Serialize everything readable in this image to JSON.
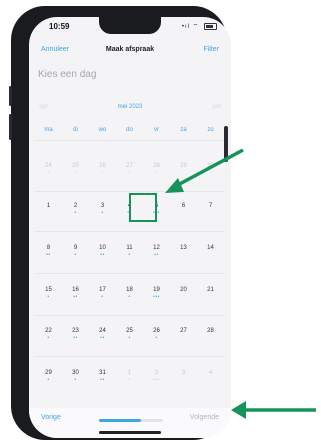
{
  "status_bar": {
    "time": "10:59",
    "signal_text": "•ıl ⌔"
  },
  "nav": {
    "left": "Annuleer",
    "title": "Maak afspraak",
    "right": "Filter"
  },
  "subtitle": "Kies een dag",
  "calendar": {
    "prev_month": "apr",
    "month": "mei 2023",
    "next_month": "jun",
    "weekdays": [
      "ma",
      "di",
      "wo",
      "do",
      "vr",
      "za",
      "zo"
    ],
    "weeks": [
      [
        {
          "d": "24",
          "dots": "•",
          "m": true
        },
        {
          "d": "25",
          "dots": "•",
          "m": true
        },
        {
          "d": "26",
          "dots": "•",
          "m": true
        },
        {
          "d": "27",
          "dots": "•",
          "m": true
        },
        {
          "d": "28",
          "dots": "•",
          "m": true
        },
        {
          "d": "29",
          "dots": "",
          "m": true
        },
        {
          "d": "30",
          "dots": "",
          "m": true
        }
      ],
      [
        {
          "d": "1",
          "dots": ""
        },
        {
          "d": "2",
          "dots": "•"
        },
        {
          "d": "3",
          "dots": "•"
        },
        {
          "d": "4",
          "dots": "••"
        },
        {
          "d": "5",
          "dots": "•••"
        },
        {
          "d": "6",
          "dots": ""
        },
        {
          "d": "7",
          "dots": ""
        }
      ],
      [
        {
          "d": "8",
          "dots": "••"
        },
        {
          "d": "9",
          "dots": "•"
        },
        {
          "d": "10",
          "dots": "••"
        },
        {
          "d": "11",
          "dots": "•"
        },
        {
          "d": "12",
          "dots": "••"
        },
        {
          "d": "13",
          "dots": ""
        },
        {
          "d": "14",
          "dots": ""
        }
      ],
      [
        {
          "d": "15",
          "dots": "•"
        },
        {
          "d": "16",
          "dots": "••"
        },
        {
          "d": "17",
          "dots": "•"
        },
        {
          "d": "18",
          "dots": "•"
        },
        {
          "d": "19",
          "dots": "•••"
        },
        {
          "d": "20",
          "dots": ""
        },
        {
          "d": "21",
          "dots": ""
        }
      ],
      [
        {
          "d": "22",
          "dots": "•"
        },
        {
          "d": "23",
          "dots": "••"
        },
        {
          "d": "24",
          "dots": "••"
        },
        {
          "d": "25",
          "dots": "•"
        },
        {
          "d": "26",
          "dots": "•"
        },
        {
          "d": "27",
          "dots": ""
        },
        {
          "d": "28",
          "dots": ""
        }
      ],
      [
        {
          "d": "29",
          "dots": "•"
        },
        {
          "d": "30",
          "dots": "•"
        },
        {
          "d": "31",
          "dots": "••"
        },
        {
          "d": "1",
          "dots": "•",
          "m": true
        },
        {
          "d": "2",
          "dots": "•••",
          "m": true
        },
        {
          "d": "3",
          "dots": "",
          "m": true
        },
        {
          "d": "4",
          "dots": "",
          "m": true
        }
      ]
    ],
    "selected_day": "5"
  },
  "footer": {
    "prev": "Vorige",
    "next": "Volgende",
    "progress": 0.66
  },
  "colors": {
    "accent": "#3ea6e0",
    "annotation": "#15935a"
  }
}
